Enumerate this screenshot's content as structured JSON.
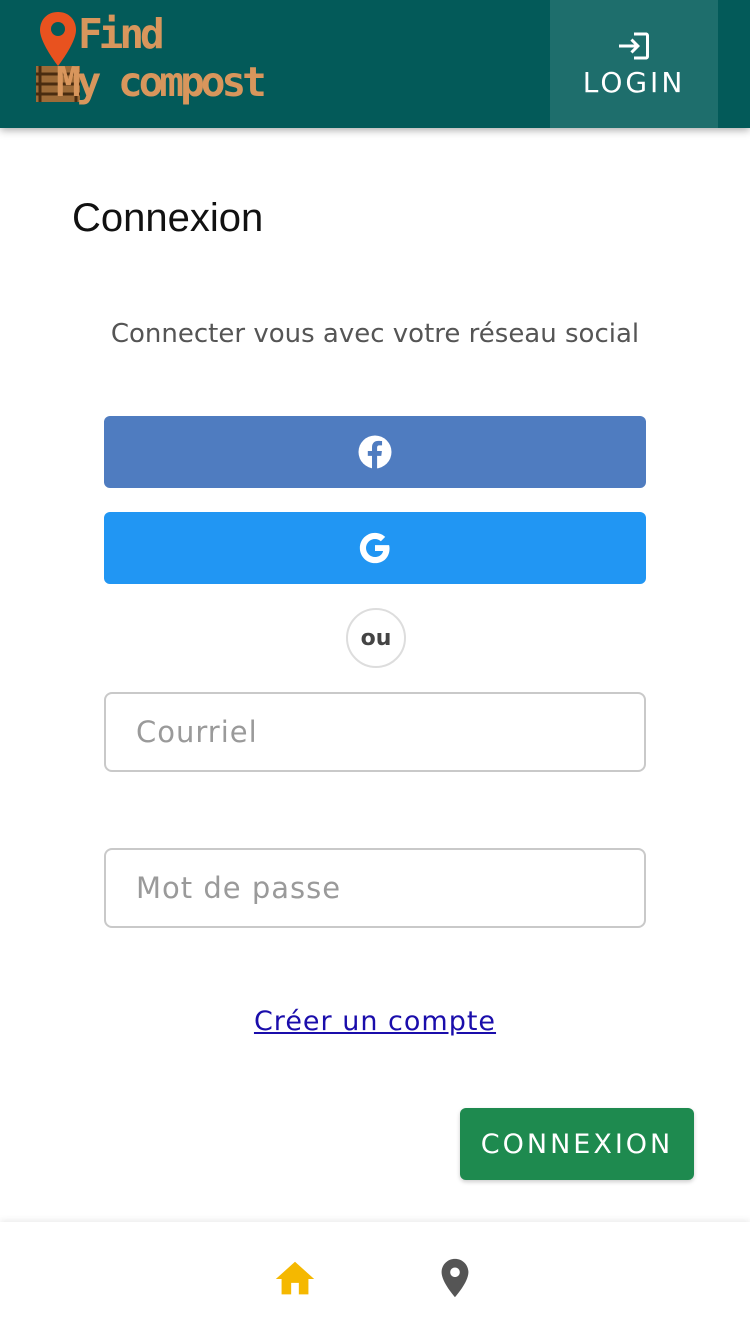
{
  "header": {
    "logo": {
      "line1": "Find",
      "line2": "My compost"
    },
    "login_label": "LOGIN",
    "login_icon": "login-icon",
    "colors": {
      "bar": "#035a59",
      "login_bg": "#1e6e6c",
      "logo_text": "#d8965c",
      "pin": "#e8521f"
    }
  },
  "main": {
    "title": "Connexion",
    "social_caption": "Connecter vous avec votre réseau social",
    "social_buttons": [
      {
        "provider": "facebook",
        "icon": "facebook-icon",
        "color": "#4f7cc0"
      },
      {
        "provider": "google",
        "icon": "google-icon",
        "color": "#2196f3"
      }
    ],
    "divider_label": "ou",
    "email": {
      "placeholder": "Courriel",
      "value": ""
    },
    "password": {
      "placeholder": "Mot de passe",
      "value": ""
    },
    "create_account_label": "Créer un compte",
    "submit_label": "CONNEXION",
    "submit_color": "#1e8a4f"
  },
  "bottom_nav": {
    "items": [
      {
        "name": "home",
        "icon": "home-icon",
        "color": "#f5b800",
        "active": true
      },
      {
        "name": "map",
        "icon": "map-pin-icon",
        "color": "#555555",
        "active": false
      }
    ]
  }
}
